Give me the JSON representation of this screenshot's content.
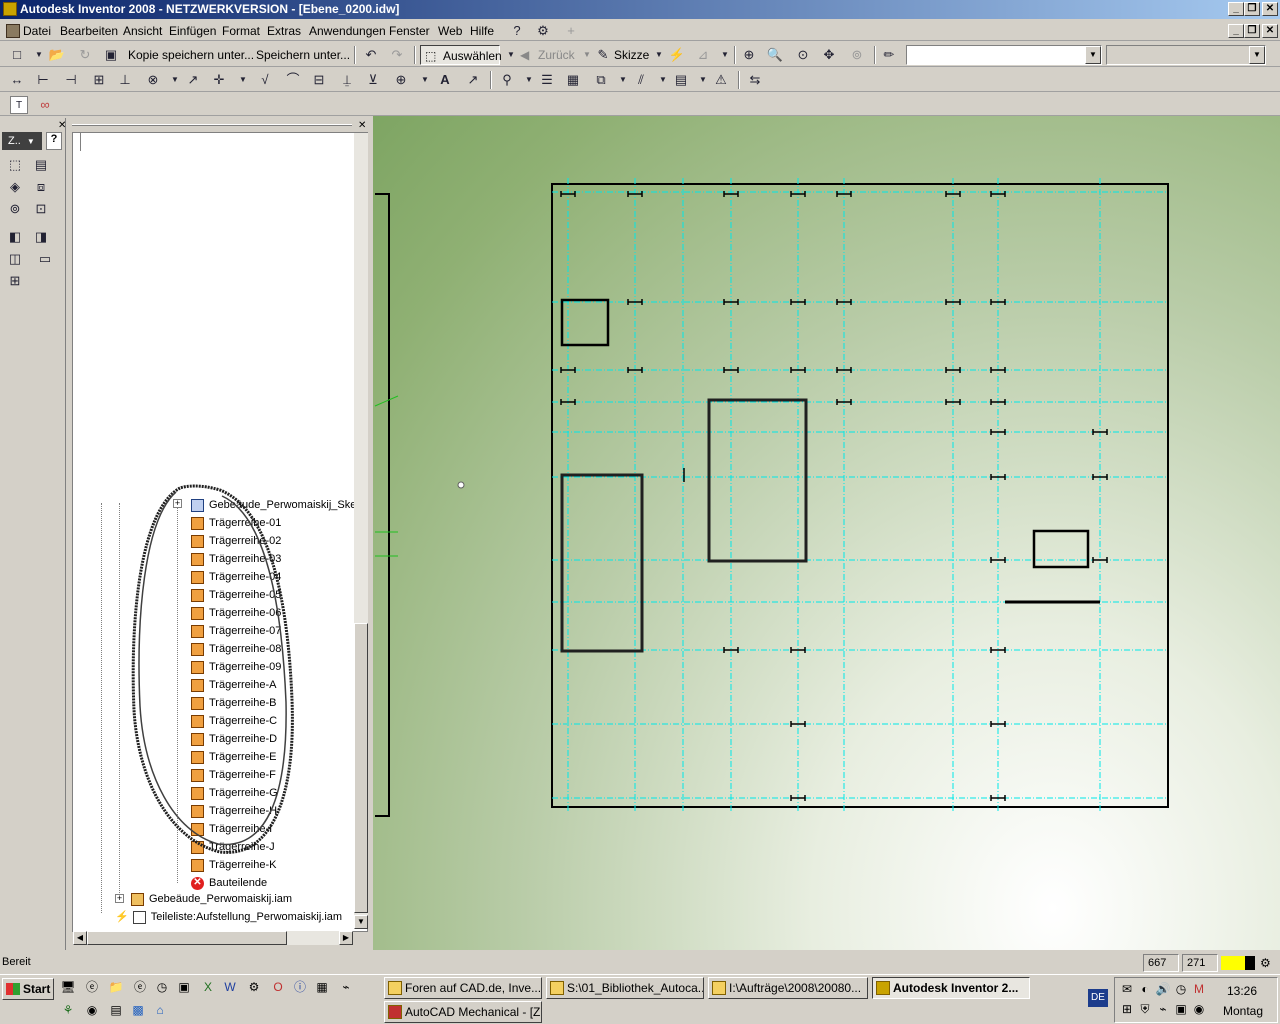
{
  "window": {
    "title": "Autodesk Inventor 2008 - NETZWERKVERSION - [Ebene_0200.idw]"
  },
  "menu": [
    "Datei",
    "Bearbeiten",
    "Ansicht",
    "Einfügen",
    "Format",
    "Extras",
    "Anwendungen",
    "Fenster",
    "Web",
    "Hilfe"
  ],
  "toolbar1": {
    "save_copy_as": "Kopie speichern unter...",
    "save_as": "Speichern unter...",
    "select": "Auswählen",
    "back": "Zurück",
    "sketch": "Skizze"
  },
  "panel": {
    "mode_label": "Z.."
  },
  "browser": {
    "items": [
      {
        "label": "Gebeäude_Perwomaiskij_Skel",
        "type": "assembly"
      },
      {
        "label": "Trägerreihe-01",
        "type": "part"
      },
      {
        "label": "Trägerreihe-02",
        "type": "part"
      },
      {
        "label": "Trägerreihe-03",
        "type": "part"
      },
      {
        "label": "Trägerreihe-04",
        "type": "part"
      },
      {
        "label": "Trägerreihe-05",
        "type": "part"
      },
      {
        "label": "Trägerreihe-06",
        "type": "part"
      },
      {
        "label": "Trägerreihe-07",
        "type": "part"
      },
      {
        "label": "Trägerreihe-08",
        "type": "part"
      },
      {
        "label": "Trägerreihe-09",
        "type": "part"
      },
      {
        "label": "Trägerreihe-A",
        "type": "part"
      },
      {
        "label": "Trägerreihe-B",
        "type": "part"
      },
      {
        "label": "Trägerreihe-C",
        "type": "part"
      },
      {
        "label": "Trägerreihe-D",
        "type": "part"
      },
      {
        "label": "Trägerreihe-E",
        "type": "part"
      },
      {
        "label": "Trägerreihe-F",
        "type": "part"
      },
      {
        "label": "Trägerreihe-G",
        "type": "part"
      },
      {
        "label": "Trägerreihe-H",
        "type": "part"
      },
      {
        "label": "Trägerreihe-I",
        "type": "part"
      },
      {
        "label": "Trägerreihe-J",
        "type": "part"
      },
      {
        "label": "Trägerreihe-K",
        "type": "part"
      },
      {
        "label": "Bauteilende",
        "type": "end"
      }
    ],
    "assembly_file": "Gebeäude_Perwomaiskij.iam",
    "parts_list": "Teileliste:Aufstellung_Perwomaiskij.iam"
  },
  "status": {
    "text": "Bereit",
    "x": "667",
    "y": "271"
  },
  "taskbar": {
    "start": "Start",
    "windows": [
      {
        "label": "Foren auf CAD.de, Inve...",
        "active": false
      },
      {
        "label": "S:\\01_Bibliothek_Autoca...",
        "active": false
      },
      {
        "label": "I:\\Aufträge\\2008\\20080...",
        "active": false
      },
      {
        "label": "Autodesk Inventor 2...",
        "active": true
      },
      {
        "label": "AutoCAD Mechanical - [Z...",
        "active": false
      }
    ],
    "lang": "DE",
    "time": "13:26",
    "day": "Montag"
  },
  "colors": {
    "titlebar_start": "#0a246a",
    "titlebar_end": "#a6caf0",
    "grid_line": "#00e0e0",
    "sheet_border": "#000000",
    "annotation": "#ff6040"
  }
}
